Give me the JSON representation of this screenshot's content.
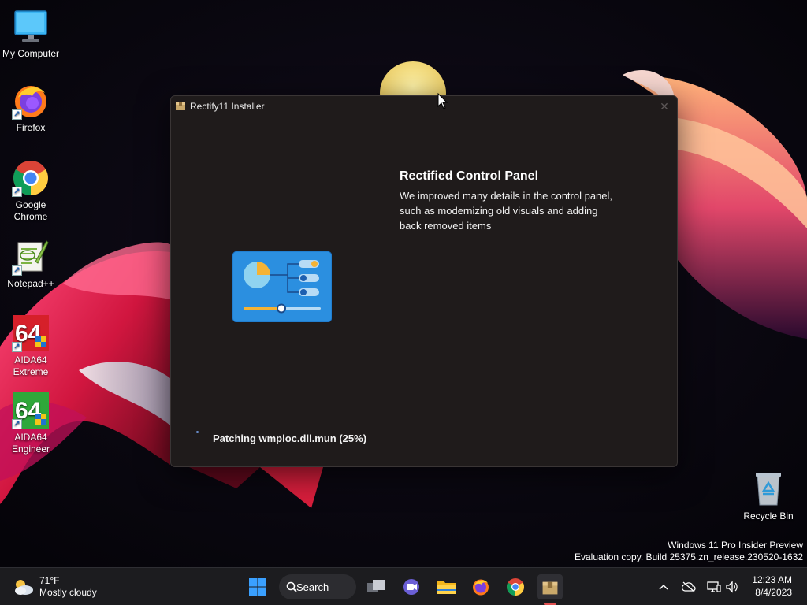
{
  "desktop": {
    "icons": [
      {
        "label": "My Computer"
      },
      {
        "label": "Firefox"
      },
      {
        "label": "Google Chrome"
      },
      {
        "label": "Notepad++"
      },
      {
        "label": "AIDA64 Extreme"
      },
      {
        "label": "AIDA64 Engineer"
      },
      {
        "label": "Recycle Bin"
      }
    ],
    "watermark": {
      "line1": "Windows 11 Pro Insider Preview",
      "line2": "Evaluation copy. Build 25375.zn_release.230520-1632"
    }
  },
  "installer": {
    "title": "Rectify11 Installer",
    "close_glyph": "✕",
    "feature_title": "Rectified Control Panel",
    "feature_description": "We improved many details in the control panel, such as modernizing old visuals and adding back removed items",
    "status": "Patching wmploc.dll.mun (25%)"
  },
  "taskbar": {
    "weather": {
      "temp": "71°F",
      "condition": "Mostly cloudy"
    },
    "search_label": "Search",
    "pinned": [
      "start-icon",
      "task-view-icon",
      "chat-icon",
      "file-explorer-icon",
      "firefox-icon",
      "chrome-icon",
      "rectify11-installer-icon"
    ],
    "clock": {
      "time": "12:23 AM",
      "date": "8/4/2023"
    }
  },
  "colors": {
    "window_bg": "#1f1b1b",
    "taskbar_bg": "#1c1c1f",
    "accent_blue": "#2f7fd8",
    "active_indicator": "#e05050"
  }
}
